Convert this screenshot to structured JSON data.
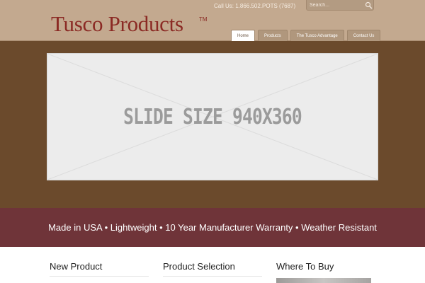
{
  "header": {
    "logo": "Tusco Products",
    "trademark": "TM",
    "phone": "Call Us: 1.866.502.POTS (7687)",
    "search_placeholder": "Search..."
  },
  "nav": {
    "items": [
      {
        "label": "Home",
        "active": true
      },
      {
        "label": "Products",
        "active": false
      },
      {
        "label": "The Tusco Advantage",
        "active": false
      },
      {
        "label": "Contact Us",
        "active": false
      }
    ]
  },
  "slider": {
    "placeholder_text": "SLIDE SIZE 940X360"
  },
  "tagline": "Made in USA • Lightweight • 10 Year Manufacturer Warranty • Weather Resistant",
  "columns": [
    {
      "heading": "New Product"
    },
    {
      "heading": "Product Selection"
    },
    {
      "heading": "Where To Buy"
    }
  ],
  "colors": {
    "header_bg": "#c3a98f",
    "brand": "#8b2a24",
    "band_bg": "#6b4a2c",
    "tagline_bg": "#6f3439"
  },
  "icons": {
    "search": "magnifier-icon"
  }
}
